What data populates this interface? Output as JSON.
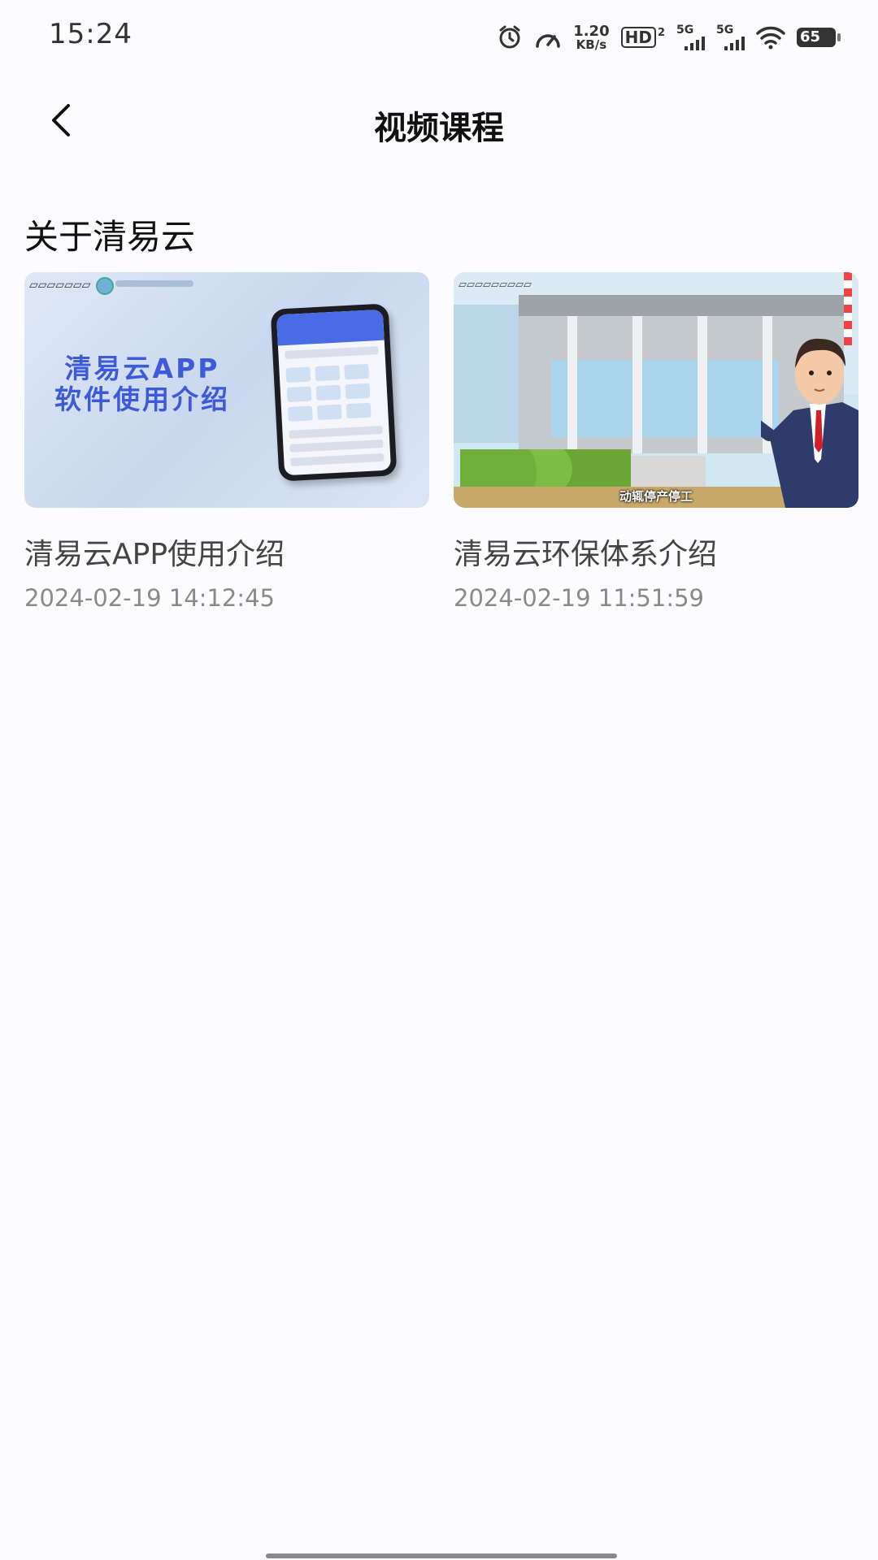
{
  "status_bar": {
    "time": "15:24",
    "network_speed_value": "1.20",
    "network_speed_unit": "KB/s",
    "hd_label": "HD",
    "hd_sub": "2",
    "signal1_label": "5G",
    "signal2_label": "5G",
    "battery": "65",
    "icons": [
      "alarm-icon",
      "speedometer-icon",
      "wifi-icon",
      "battery-icon"
    ]
  },
  "header": {
    "title": "视频课程",
    "back_icon": "chevron-left-icon"
  },
  "section": {
    "title": "关于清易云"
  },
  "videos": [
    {
      "title": "清易云APP使用介绍",
      "date": "2024-02-19 14:12:45",
      "thumb_text_line1": "清易云APP",
      "thumb_text_line2": "软件使用介绍"
    },
    {
      "title": "清易云环保体系介绍",
      "date": "2024-02-19 11:51:59",
      "thumb_subtitle": "动辄停产停工"
    }
  ]
}
